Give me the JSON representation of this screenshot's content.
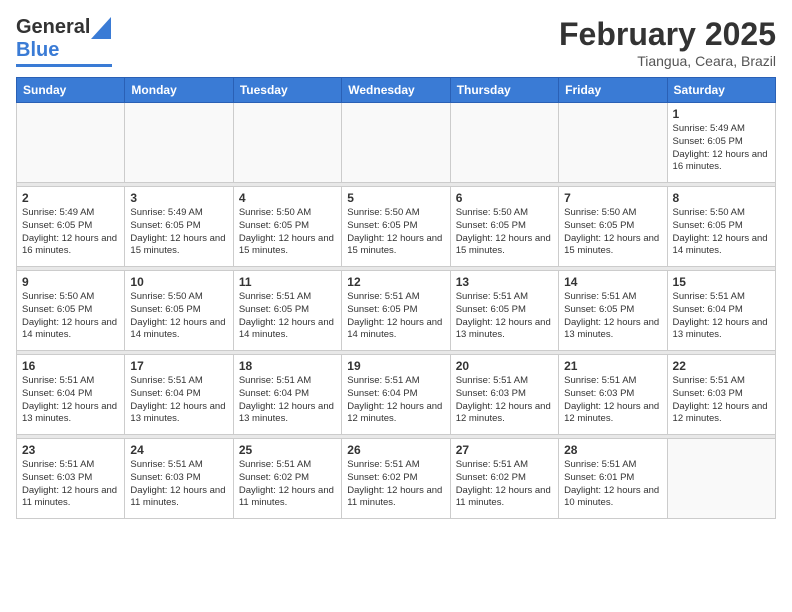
{
  "header": {
    "logo": {
      "general": "General",
      "blue": "Blue"
    },
    "title": "February 2025",
    "subtitle": "Tiangua, Ceara, Brazil"
  },
  "weekdays": [
    "Sunday",
    "Monday",
    "Tuesday",
    "Wednesday",
    "Thursday",
    "Friday",
    "Saturday"
  ],
  "weeks": [
    [
      {
        "day": "",
        "info": ""
      },
      {
        "day": "",
        "info": ""
      },
      {
        "day": "",
        "info": ""
      },
      {
        "day": "",
        "info": ""
      },
      {
        "day": "",
        "info": ""
      },
      {
        "day": "",
        "info": ""
      },
      {
        "day": "1",
        "info": "Sunrise: 5:49 AM\nSunset: 6:05 PM\nDaylight: 12 hours\nand 16 minutes."
      }
    ],
    [
      {
        "day": "2",
        "info": "Sunrise: 5:49 AM\nSunset: 6:05 PM\nDaylight: 12 hours\nand 16 minutes."
      },
      {
        "day": "3",
        "info": "Sunrise: 5:49 AM\nSunset: 6:05 PM\nDaylight: 12 hours\nand 15 minutes."
      },
      {
        "day": "4",
        "info": "Sunrise: 5:50 AM\nSunset: 6:05 PM\nDaylight: 12 hours\nand 15 minutes."
      },
      {
        "day": "5",
        "info": "Sunrise: 5:50 AM\nSunset: 6:05 PM\nDaylight: 12 hours\nand 15 minutes."
      },
      {
        "day": "6",
        "info": "Sunrise: 5:50 AM\nSunset: 6:05 PM\nDaylight: 12 hours\nand 15 minutes."
      },
      {
        "day": "7",
        "info": "Sunrise: 5:50 AM\nSunset: 6:05 PM\nDaylight: 12 hours\nand 15 minutes."
      },
      {
        "day": "8",
        "info": "Sunrise: 5:50 AM\nSunset: 6:05 PM\nDaylight: 12 hours\nand 14 minutes."
      }
    ],
    [
      {
        "day": "9",
        "info": "Sunrise: 5:50 AM\nSunset: 6:05 PM\nDaylight: 12 hours\nand 14 minutes."
      },
      {
        "day": "10",
        "info": "Sunrise: 5:50 AM\nSunset: 6:05 PM\nDaylight: 12 hours\nand 14 minutes."
      },
      {
        "day": "11",
        "info": "Sunrise: 5:51 AM\nSunset: 6:05 PM\nDaylight: 12 hours\nand 14 minutes."
      },
      {
        "day": "12",
        "info": "Sunrise: 5:51 AM\nSunset: 6:05 PM\nDaylight: 12 hours\nand 14 minutes."
      },
      {
        "day": "13",
        "info": "Sunrise: 5:51 AM\nSunset: 6:05 PM\nDaylight: 12 hours\nand 13 minutes."
      },
      {
        "day": "14",
        "info": "Sunrise: 5:51 AM\nSunset: 6:05 PM\nDaylight: 12 hours\nand 13 minutes."
      },
      {
        "day": "15",
        "info": "Sunrise: 5:51 AM\nSunset: 6:04 PM\nDaylight: 12 hours\nand 13 minutes."
      }
    ],
    [
      {
        "day": "16",
        "info": "Sunrise: 5:51 AM\nSunset: 6:04 PM\nDaylight: 12 hours\nand 13 minutes."
      },
      {
        "day": "17",
        "info": "Sunrise: 5:51 AM\nSunset: 6:04 PM\nDaylight: 12 hours\nand 13 minutes."
      },
      {
        "day": "18",
        "info": "Sunrise: 5:51 AM\nSunset: 6:04 PM\nDaylight: 12 hours\nand 13 minutes."
      },
      {
        "day": "19",
        "info": "Sunrise: 5:51 AM\nSunset: 6:04 PM\nDaylight: 12 hours\nand 12 minutes."
      },
      {
        "day": "20",
        "info": "Sunrise: 5:51 AM\nSunset: 6:03 PM\nDaylight: 12 hours\nand 12 minutes."
      },
      {
        "day": "21",
        "info": "Sunrise: 5:51 AM\nSunset: 6:03 PM\nDaylight: 12 hours\nand 12 minutes."
      },
      {
        "day": "22",
        "info": "Sunrise: 5:51 AM\nSunset: 6:03 PM\nDaylight: 12 hours\nand 12 minutes."
      }
    ],
    [
      {
        "day": "23",
        "info": "Sunrise: 5:51 AM\nSunset: 6:03 PM\nDaylight: 12 hours\nand 11 minutes."
      },
      {
        "day": "24",
        "info": "Sunrise: 5:51 AM\nSunset: 6:03 PM\nDaylight: 12 hours\nand 11 minutes."
      },
      {
        "day": "25",
        "info": "Sunrise: 5:51 AM\nSunset: 6:02 PM\nDaylight: 12 hours\nand 11 minutes."
      },
      {
        "day": "26",
        "info": "Sunrise: 5:51 AM\nSunset: 6:02 PM\nDaylight: 12 hours\nand 11 minutes."
      },
      {
        "day": "27",
        "info": "Sunrise: 5:51 AM\nSunset: 6:02 PM\nDaylight: 12 hours\nand 11 minutes."
      },
      {
        "day": "28",
        "info": "Sunrise: 5:51 AM\nSunset: 6:01 PM\nDaylight: 12 hours\nand 10 minutes."
      },
      {
        "day": "",
        "info": ""
      }
    ]
  ]
}
